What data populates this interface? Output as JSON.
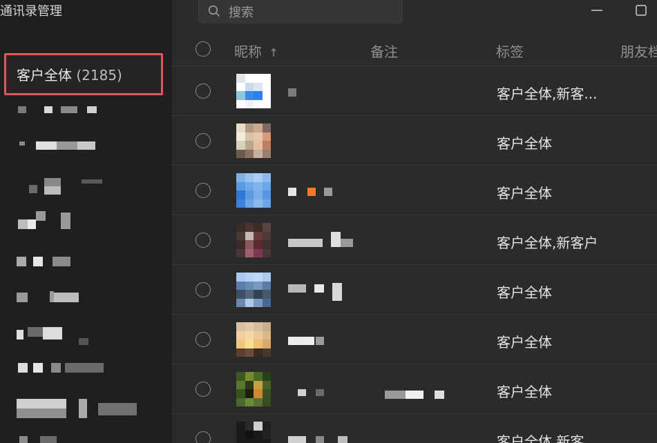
{
  "sidebar": {
    "title": "通讯录管理",
    "selected_group": {
      "name": "客户全体",
      "count": "(2185)"
    }
  },
  "search": {
    "placeholder": "搜索"
  },
  "columns": {
    "nickname": "昵称",
    "sort_arrow": "↑",
    "remark": "备注",
    "tags": "标签",
    "moments": "朋友档"
  },
  "rows": [
    {
      "tags": "客户全体,新客..."
    },
    {
      "tags": "客户全体"
    },
    {
      "tags": "客户全体"
    },
    {
      "tags": "客户全体,新客户"
    },
    {
      "tags": "客户全体"
    },
    {
      "tags": "客户全体"
    },
    {
      "tags": "客户全体"
    },
    {
      "tags": "客户全体,新客"
    }
  ],
  "colors": {
    "sidebar_bg": "#1f1f1f",
    "main_bg": "#2b2b2b",
    "selection_border": "#e5545c",
    "text": "#e4e4e4",
    "header_text": "#8f8f8f"
  }
}
